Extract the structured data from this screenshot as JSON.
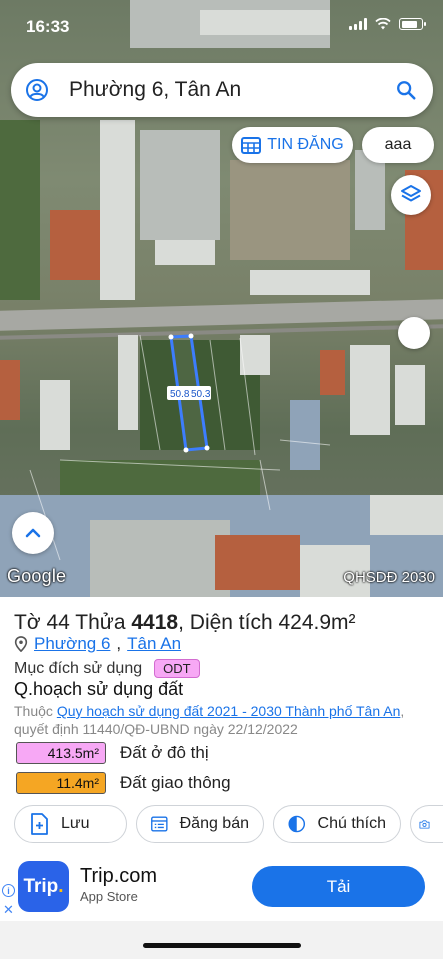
{
  "status_bar": {
    "time": "16:33"
  },
  "search": {
    "query": "Phường 6, Tân An"
  },
  "chips": {
    "listings": "TIN ĐĂNG",
    "user": "aaa"
  },
  "map": {
    "google_logo": "Google",
    "credit": "QHSDĐ 2030",
    "plot_edge_labels": [
      "50.8",
      "50.3"
    ]
  },
  "parcel": {
    "title_prefix": "Tờ",
    "sheet": "44",
    "lot_prefix": "Thửa",
    "lot": "4418",
    "area_prefix": "Diện tích",
    "area": "424.9m²",
    "ward": "Phường 6",
    "city": "Tân An",
    "purpose_label": "Mục đích sử dụng",
    "purpose_code": "ODT",
    "plan_heading": "Q.hoạch sử dụng đất",
    "plan_prefix": "Thuộc",
    "plan_link": "Quy hoạch sử dụng đất 2021 - 2030 Thành phố Tân An",
    "plan_decision": ", quyết định 11440/QĐ-UBND ngày 22/12/2022",
    "land_uses": [
      {
        "area": "413.5m²",
        "label": "Đất ở đô thị",
        "color": "#f7a8f5"
      },
      {
        "area": "11.4m²",
        "label": "Đất giao thông",
        "color": "#f5a623"
      }
    ]
  },
  "actions": {
    "save": "Lưu",
    "post": "Đăng bán",
    "legend": "Chú thích"
  },
  "ad": {
    "logo_text": "Trip",
    "app_name": "Trip.com",
    "store": "App Store",
    "cta": "Tải"
  },
  "icons": {
    "avatar": "account-circle-icon",
    "search": "search-icon",
    "calendar": "calendar-grid-icon",
    "layers": "layers-icon",
    "chevron_up": "chevron-up-icon",
    "pin": "location-pin-icon",
    "save": "bookmark-plus-icon",
    "post": "list-post-icon",
    "legend": "half-circle-icon",
    "camera": "camera-add-icon"
  }
}
